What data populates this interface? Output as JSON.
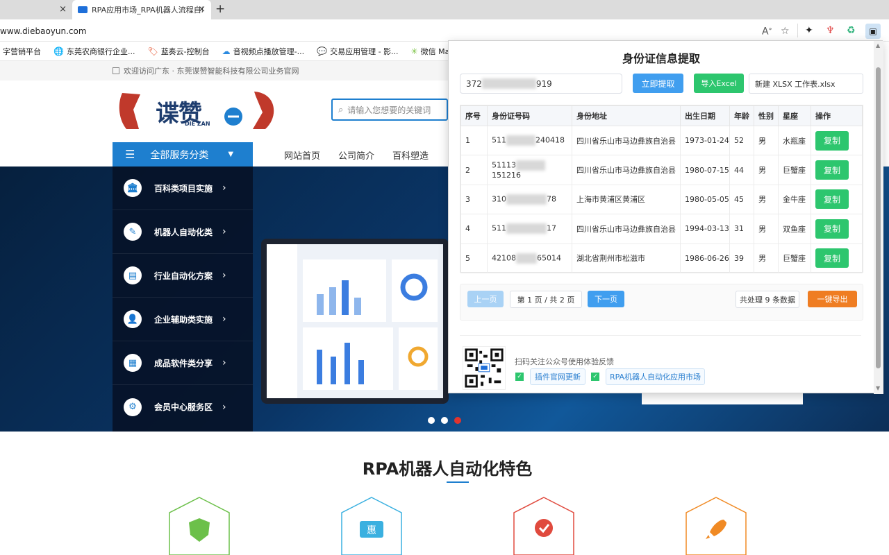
{
  "browser": {
    "tab1_close": "×",
    "tab2_title": "RPA应用市场_RPA机器人流程自动",
    "tab2_close": "×",
    "new_tab": "+",
    "url": "www.diebaoyun.com",
    "bookmarks": [
      {
        "label": "字营销平台",
        "icon": ""
      },
      {
        "label": "东莞农商银行企业...",
        "icon": "🌐"
      },
      {
        "label": "蓝奏云-控制台",
        "icon": "🏷"
      },
      {
        "label": "音视频点播放管理-...",
        "icon": "☁"
      },
      {
        "label": "交易应用管理 - 影...",
        "icon": "💬"
      },
      {
        "label": "微信 Markdown 编...",
        "icon": "✳"
      }
    ]
  },
  "site": {
    "notice": "欢迎访问广东 · 东莞谍赞智能科技有限公司业务官网",
    "logo_text": "谍赞",
    "logo_sub": "DIE ZAN",
    "search_placeholder": "请输入您想要的关键词",
    "category_button": "全部服务分类",
    "nav": [
      "网站首页",
      "公司简介",
      "百科塑造"
    ],
    "categories": [
      {
        "label": "百科类项目实施",
        "icon": "🏛"
      },
      {
        "label": "机器人自动化类",
        "icon": "✎"
      },
      {
        "label": "行业自动化方案",
        "icon": "▤"
      },
      {
        "label": "企业辅助类实施",
        "icon": "👤"
      },
      {
        "label": "成品软件类分享",
        "icon": "▦"
      },
      {
        "label": "会员中心服务区",
        "icon": "⚙"
      }
    ],
    "features_title": "RPA机器人自动化特色"
  },
  "popup": {
    "title": "身份证信息提取",
    "id_input_prefix": "372",
    "id_input_suffix": "919",
    "extract_button": "立即提取",
    "import_button": "导入Excel",
    "file_name": "新建 XLSX 工作表.xlsx",
    "columns": [
      "序号",
      "身份证号码",
      "身份地址",
      "出生日期",
      "年龄",
      "性别",
      "星座",
      "操作"
    ],
    "rows": [
      {
        "idx": "1",
        "id_pre": "511",
        "id_post": "240418",
        "address": "四川省乐山市马边彝族自治县",
        "birth": "1973-01-24",
        "age": "52",
        "gender": "男",
        "zodiac": "水瓶座",
        "action": "复制"
      },
      {
        "idx": "2",
        "id_pre": "51113",
        "id_post": "151216",
        "address": "四川省乐山市马边彝族自治县",
        "birth": "1980-07-15",
        "age": "44",
        "gender": "男",
        "zodiac": "巨蟹座",
        "action": "复制"
      },
      {
        "idx": "3",
        "id_pre": "310",
        "id_post": "78",
        "address": "上海市黄浦区黄浦区",
        "birth": "1980-05-05",
        "age": "45",
        "gender": "男",
        "zodiac": "金牛座",
        "action": "复制"
      },
      {
        "idx": "4",
        "id_pre": "511",
        "id_post": "17",
        "address": "四川省乐山市马边彝族自治县",
        "birth": "1994-03-13",
        "age": "31",
        "gender": "男",
        "zodiac": "双鱼座",
        "action": "复制"
      },
      {
        "idx": "5",
        "id_pre": "42108",
        "id_post": "65014",
        "address": "湖北省荆州市松滋市",
        "birth": "1986-06-26",
        "age": "39",
        "gender": "男",
        "zodiac": "巨蟹座",
        "action": "复制"
      }
    ],
    "prev_button": "上一页",
    "page_info": "第 1 页 / 共 2 页",
    "next_button": "下一页",
    "total_text": "共处理 9 条数据",
    "export_button": "一键导出",
    "scan_text": "扫码关注公众号使用体验反馈",
    "link1": "插件官网更新",
    "link2": "RPA机器人自动化应用市场"
  },
  "colors": {
    "primary": "#409eef",
    "success": "#2dc66e",
    "warning": "#ef7d22",
    "brand_blue": "#1e7fcf"
  }
}
